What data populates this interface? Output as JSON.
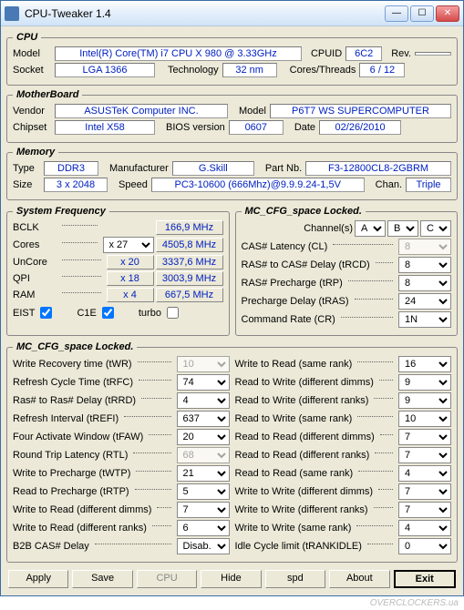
{
  "window": {
    "title": "CPU-Tweaker 1.4"
  },
  "cpu": {
    "legend": "CPU",
    "model_lbl": "Model",
    "model": "Intel(R) Core(TM) i7 CPU       X 980  @ 3.33GHz",
    "cpuid_lbl": "CPUID",
    "cpuid": "6C2",
    "rev_lbl": "Rev.",
    "socket_lbl": "Socket",
    "socket": "LGA 1366",
    "tech_lbl": "Technology",
    "tech": "32 nm",
    "ct_lbl": "Cores/Threads",
    "ct": "6 / 12"
  },
  "mb": {
    "legend": "MotherBoard",
    "vendor_lbl": "Vendor",
    "vendor": "ASUSTeK Computer INC.",
    "model_lbl": "Model",
    "model": "P6T7 WS SUPERCOMPUTER",
    "chipset_lbl": "Chipset",
    "chipset": "Intel X58",
    "bios_lbl": "BIOS version",
    "bios": "0607",
    "date_lbl": "Date",
    "date": "02/26/2010"
  },
  "mem": {
    "legend": "Memory",
    "type_lbl": "Type",
    "type": "DDR3",
    "mfr_lbl": "Manufacturer",
    "mfr": "G.Skill",
    "part_lbl": "Part Nb.",
    "part": "F3-12800CL8-2GBRM",
    "size_lbl": "Size",
    "size": "3 x 2048",
    "speed_lbl": "Speed",
    "speed": "PC3-10600 (666Mhz)@9.9.9.24-1,5V",
    "chan_lbl": "Chan.",
    "chan": "Triple"
  },
  "sysfreq": {
    "legend": "System Frequency",
    "bclk_lbl": "BCLK",
    "bclk": "166,9 MHz",
    "cores_lbl": "Cores",
    "cores_mult": "x 27",
    "cores_f": "4505,8 MHz",
    "uncore_lbl": "UnCore",
    "uncore_mult": "x 20",
    "uncore_f": "3337,6 MHz",
    "qpi_lbl": "QPI",
    "qpi_mult": "x 18",
    "qpi_f": "3003,9 MHz",
    "ram_lbl": "RAM",
    "ram_mult": "x 4",
    "ram_f": "667,5 MHz",
    "eist_lbl": "EIST",
    "c1e_lbl": "C1E",
    "turbo_lbl": "turbo"
  },
  "mccfg1": {
    "legend": "MC_CFG_space Locked.",
    "chan_lbl": "Channel(s)",
    "chanA": "A",
    "chanB": "B",
    "chanC": "C",
    "cl_lbl": "CAS# Latency (CL)",
    "cl": "8",
    "trcd_lbl": "RAS# to CAS# Delay (tRCD)",
    "trcd": "8",
    "trp_lbl": "RAS# Precharge (tRP)",
    "trp": "8",
    "tras_lbl": "Precharge Delay (tRAS)",
    "tras": "24",
    "cr_lbl": "Command Rate (CR)",
    "cr": "1N"
  },
  "mccfg2": {
    "legend": "MC_CFG_space Locked.",
    "left": [
      {
        "lbl": "Write Recovery time (tWR)",
        "val": "10",
        "dis": true
      },
      {
        "lbl": "Refresh Cycle Time (tRFC)",
        "val": "74"
      },
      {
        "lbl": "Ras# to Ras# Delay (tRRD)",
        "val": "4"
      },
      {
        "lbl": "Refresh Interval (tREFI)",
        "val": "637"
      },
      {
        "lbl": "Four Activate Window (tFAW)",
        "val": "20"
      },
      {
        "lbl": "Round Trip Latency (RTL)",
        "val": "68",
        "dis": true
      },
      {
        "lbl": "Write to Precharge (tWTP)",
        "val": "21"
      },
      {
        "lbl": "Read to Precharge (tRTP)",
        "val": "5"
      },
      {
        "lbl": "Write to Read (different dimms)",
        "val": "7"
      },
      {
        "lbl": "Write to Read (different ranks)",
        "val": "6"
      },
      {
        "lbl": "B2B CAS# Delay",
        "val": "Disab."
      }
    ],
    "right": [
      {
        "lbl": "Write to Read (same rank)",
        "val": "16"
      },
      {
        "lbl": "Read to Write (different dimms)",
        "val": "9"
      },
      {
        "lbl": "Read to Write (different ranks)",
        "val": "9"
      },
      {
        "lbl": "Read to Write (same rank)",
        "val": "10"
      },
      {
        "lbl": "Read to Read (different dimms)",
        "val": "7"
      },
      {
        "lbl": "Read to Read (different ranks)",
        "val": "7"
      },
      {
        "lbl": "Read to Read (same rank)",
        "val": "4"
      },
      {
        "lbl": "Write to Write (different dimms)",
        "val": "7"
      },
      {
        "lbl": "Write to Write (different ranks)",
        "val": "7"
      },
      {
        "lbl": "Write to Write (same rank)",
        "val": "4"
      },
      {
        "lbl": "Idle Cycle limit (tRANKIDLE)",
        "val": "0"
      }
    ]
  },
  "buttons": {
    "apply": "Apply",
    "save": "Save",
    "cpu": "CPU",
    "hide": "Hide",
    "spd": "spd",
    "about": "About",
    "exit": "Exit"
  },
  "watermark": "OVERCLOCKERS.ua"
}
